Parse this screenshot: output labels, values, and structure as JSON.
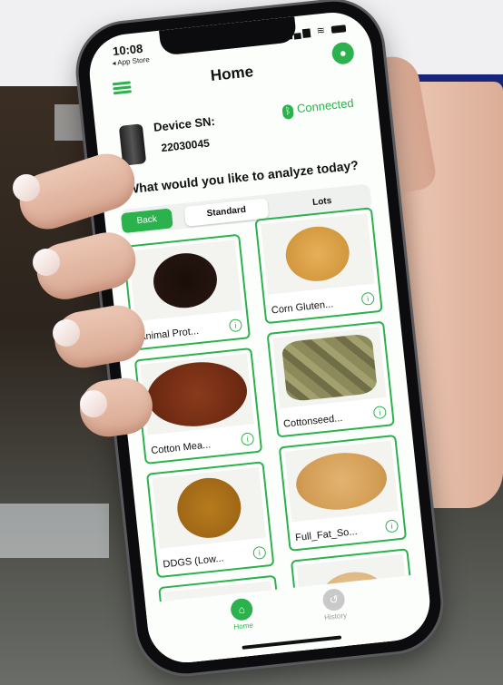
{
  "status_bar": {
    "time": "10:08",
    "back_app": "◂ App Store",
    "signal": "▂▄▆ ≋"
  },
  "header": {
    "title": "Home",
    "menu_icon": "list-icon",
    "profile_icon": "person-icon"
  },
  "device": {
    "label": "Device SN:",
    "serial": "22030045",
    "status": "Connected",
    "status_icon": "bluetooth-icon"
  },
  "prompt": "What would you like to analyze today?",
  "tabs": {
    "back": "Back",
    "standard": "Standard",
    "lots": "Lots"
  },
  "items": [
    {
      "label": "Animal Prot...",
      "info": "i"
    },
    {
      "label": "Corn Gluten...",
      "info": "i"
    },
    {
      "label": "Cotton Mea...",
      "info": "i"
    },
    {
      "label": "Cottonseed...",
      "info": "i"
    },
    {
      "label": "DDGS (Low...",
      "info": "i"
    },
    {
      "label": "Full_Fat_So...",
      "info": "i"
    },
    {
      "label": "",
      "info": ""
    },
    {
      "label": "",
      "info": ""
    }
  ],
  "bottom_nav": {
    "home": "Home",
    "history": "History"
  },
  "colors": {
    "accent": "#2bb24c",
    "navy": "#17257a"
  }
}
